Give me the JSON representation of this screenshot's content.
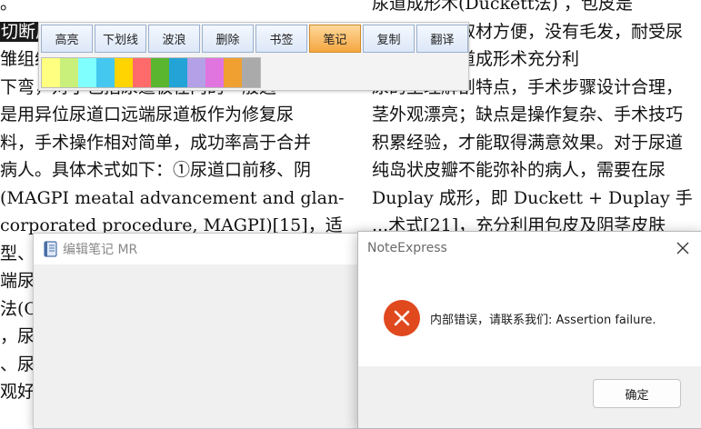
{
  "document": {
    "left_lines": [
      "。",
      "切断后遗断手术，通过阴茎皮肤隧道",
      "雏组织瓣形成尿道，MAGPI可以矫正轻度冠",
      "下弯，对于包括尿道板在内的一般远",
      "是用异位尿道口远端尿道板作为修复尿",
      "料，手术操作相对简单，成功率高于合并",
      "病人。具体术式如下：①尿道口前移、阴",
      "(MAGPI meatal advancement and glan-",
      "corporated procedure, MAGPI)[15]，适",
      "型、",
      "端尿道",
      "法(C",
      "，尿道",
      "、尿道",
      "观好"
    ],
    "right_lines": [
      "尿道成形术(Duckett法) ，包皮是",
      "茎优材料，取材方便，没有毛发，耐受尿",
      "皮瓣管状尿道成形术充分利",
      "尿的生理解剖特点，手术步骤设计合理，",
      "茎外观漂亮；缺点是操作复杂、手术技巧",
      "积累经验，才能取得满意效果。对于尿道",
      "纯岛状皮瓣不能弥补的病人，需要在尿",
      "Duplay 成形，即 Duckett + Duplay 手",
      "...术式[21]，充分利用包皮及阴茎皮肤"
    ],
    "highlight_text": "切断后"
  },
  "toolbar": {
    "buttons": [
      {
        "label": "高亮"
      },
      {
        "label": "下划线"
      },
      {
        "label": "波浪"
      },
      {
        "label": "删除"
      },
      {
        "label": "书签"
      },
      {
        "label": "笔记",
        "active": true
      },
      {
        "label": "复制"
      },
      {
        "label": "翻译"
      }
    ],
    "swatches": [
      "#ffff80",
      "#c8f07a",
      "#80ffff",
      "#44c8f0",
      "#ffd400",
      "#ff6b6b",
      "#5ab52f",
      "#23a3d6",
      "#b3a0e6",
      "#e075e0",
      "#f0a030",
      "#aaaaaa"
    ]
  },
  "edit_window": {
    "title": "编辑笔记 MR",
    "icon": "notebook-icon"
  },
  "error_dialog": {
    "title": "NoteExpress",
    "message": "内部错误，请联系我们: Assertion failure.",
    "ok_label": "确定",
    "icon": "error-icon",
    "close_icon": "close-icon",
    "accent_color": "#e0481e"
  }
}
